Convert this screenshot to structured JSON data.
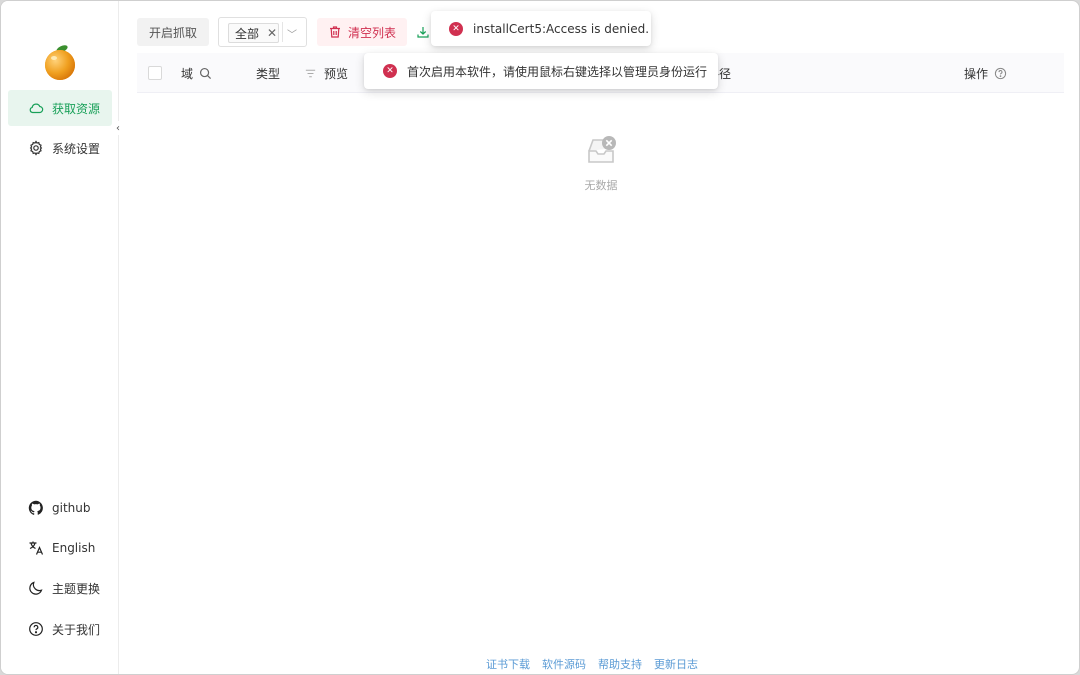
{
  "sidebar": {
    "items": [
      {
        "label": "获取资源",
        "icon": "cloud-icon",
        "active": true
      },
      {
        "label": "系统设置",
        "icon": "gear-icon",
        "active": false
      }
    ],
    "bottom_items": [
      {
        "label": "github",
        "icon": "github-icon"
      },
      {
        "label": "English",
        "icon": "translate-icon"
      },
      {
        "label": "主题更换",
        "icon": "moon-icon"
      },
      {
        "label": "关于我们",
        "icon": "help-circle-icon"
      }
    ]
  },
  "toolbar": {
    "start_label": "开启抓取",
    "filter_tag": "全部",
    "clear_label": "清空列表"
  },
  "table": {
    "columns": {
      "domain": "域",
      "type": "类型",
      "preview": "预览",
      "path": "路径",
      "actions": "操作"
    },
    "empty_text": "无数据"
  },
  "toasts": [
    {
      "message": "installCert5:Access is denied."
    },
    {
      "message": "首次启用本软件，请使用鼠标右键选择以管理员身份运行"
    }
  ],
  "footer": {
    "links": [
      "证书下载",
      "软件源码",
      "帮助支持",
      "更新日志"
    ]
  },
  "colors": {
    "accent": "#18a058",
    "error": "#d03050",
    "link": "#5b9bd5"
  }
}
